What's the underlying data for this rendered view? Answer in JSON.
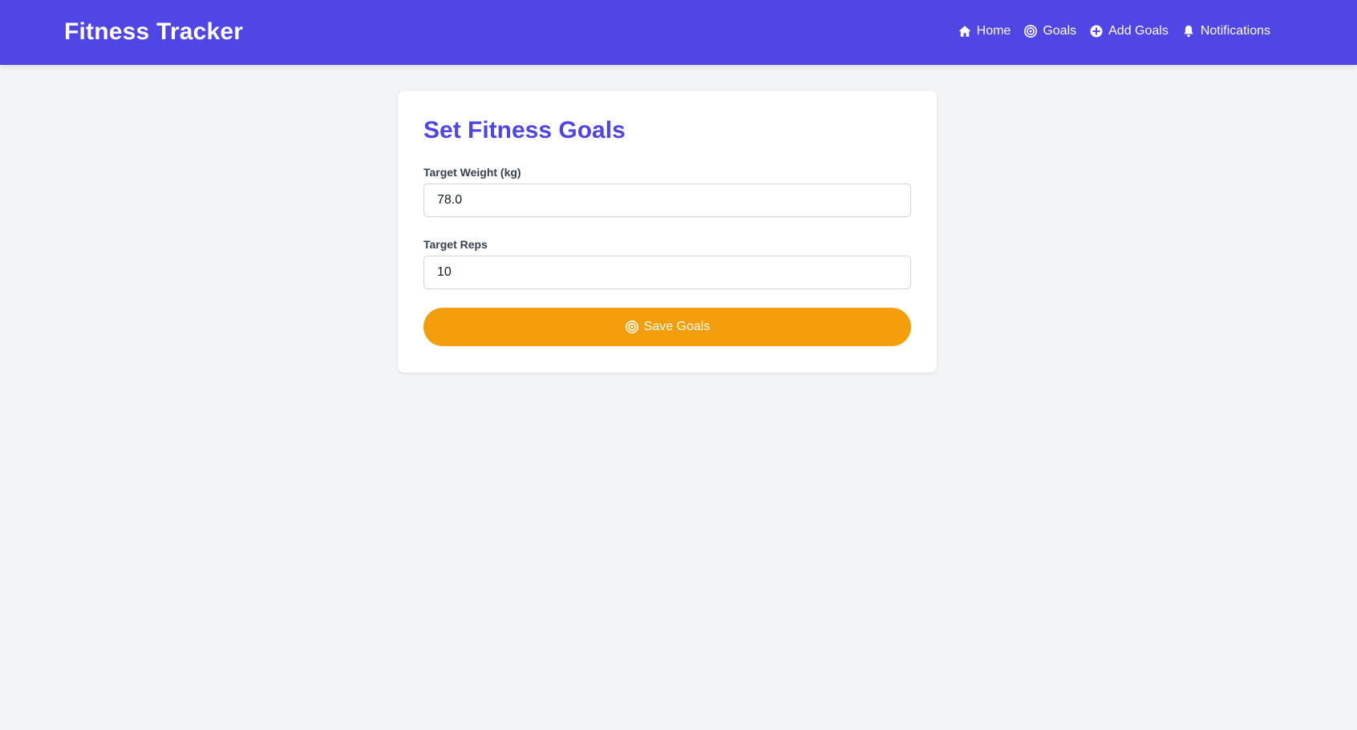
{
  "app": {
    "brand": "Fitness Tracker",
    "accent_color": "#4f46e5",
    "button_color": "#f59e0b",
    "background_color": "#f3f4f6"
  },
  "nav": {
    "items": [
      {
        "label": "Home",
        "icon": "home-icon"
      },
      {
        "label": "Goals",
        "icon": "target-icon"
      },
      {
        "label": "Add Goals",
        "icon": "plus-circle-icon"
      },
      {
        "label": "Notifications",
        "icon": "bell-icon"
      }
    ]
  },
  "form": {
    "title": "Set Fitness Goals",
    "fields": [
      {
        "label": "Target Weight (kg)",
        "value": "78.0"
      },
      {
        "label": "Target Reps",
        "value": "10"
      }
    ],
    "submit": {
      "label": "Save Goals",
      "icon": "target-icon"
    }
  }
}
